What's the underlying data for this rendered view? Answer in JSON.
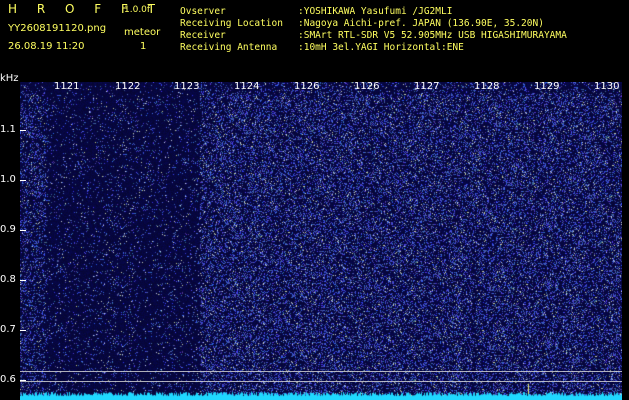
{
  "header": {
    "title": "H R O F F T",
    "version": "1.0.0f",
    "filename": "YY2608191120.png",
    "meteor_label": "meteor",
    "meteor_count": "1",
    "datetime": "26.08.19 11:20"
  },
  "info": [
    {
      "key": "Ovserver",
      "value": ":YOSHIKAWA Yasufumi /JG2MLI"
    },
    {
      "key": "Receiving Location",
      "value": ":Nagoya Aichi-pref. JAPAN (136.90E, 35.20N)"
    },
    {
      "key": "Receiver",
      "value": ":SMArt RTL-SDR V5 52.905MHz USB HIGASHIMURAYAMA"
    },
    {
      "key": "Receiving Antenna",
      "value": ":10mH 3el.YAGI Horizontal:ENE"
    }
  ],
  "axis": {
    "y_unit": "kHz",
    "y_ticks": [
      "1.1",
      "1.0",
      "0.9",
      "0.8",
      "0.7",
      "0.6"
    ],
    "x_ticks": [
      "1121",
      "1122",
      "1123",
      "1124",
      "1126",
      "1126",
      "1127",
      "1128",
      "1129",
      "1130"
    ]
  },
  "colors": {
    "text": "#ffff60",
    "spectrum_bg": "#08083a",
    "noise": "#3c50ff",
    "trace": "#20d8ff"
  }
}
